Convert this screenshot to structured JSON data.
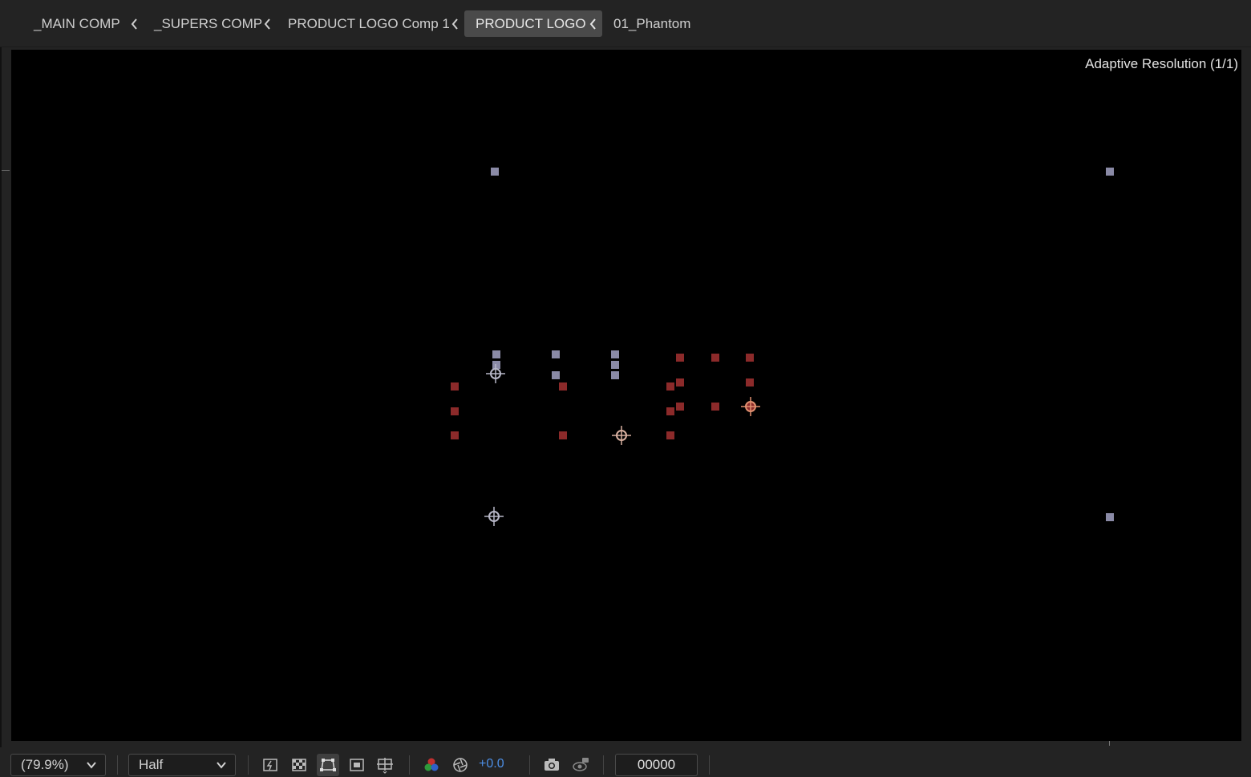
{
  "breadcrumbs": [
    {
      "label": "_MAIN COMP"
    },
    {
      "label": "_SUPERS COMP"
    },
    {
      "label": "PRODUCT LOGO Comp 1"
    },
    {
      "label": "PRODUCT LOGO"
    },
    {
      "label": "01_Phantom"
    }
  ],
  "viewer": {
    "resolution_label": "Adaptive Resolution (1/1)"
  },
  "toolbar": {
    "zoom": "(79.9%)",
    "resolution": "Half",
    "exposure": "+0.0",
    "timecode": "00000"
  },
  "colors": {
    "background": "#000000",
    "panel": "#232323",
    "handle_blue": "#8a8aa6",
    "handle_red": "#8c2a2a",
    "exposure_blue": "#4d8fe6"
  },
  "icons": [
    "chevron-left-icon",
    "chevron-down-icon",
    "fast-preview-icon",
    "transparency-grid-icon",
    "mask-path-icon",
    "region-of-interest-icon",
    "guides-icon",
    "color-channels-icon",
    "color-management-icon",
    "snapshot-camera-icon",
    "show-snapshot-icon"
  ]
}
